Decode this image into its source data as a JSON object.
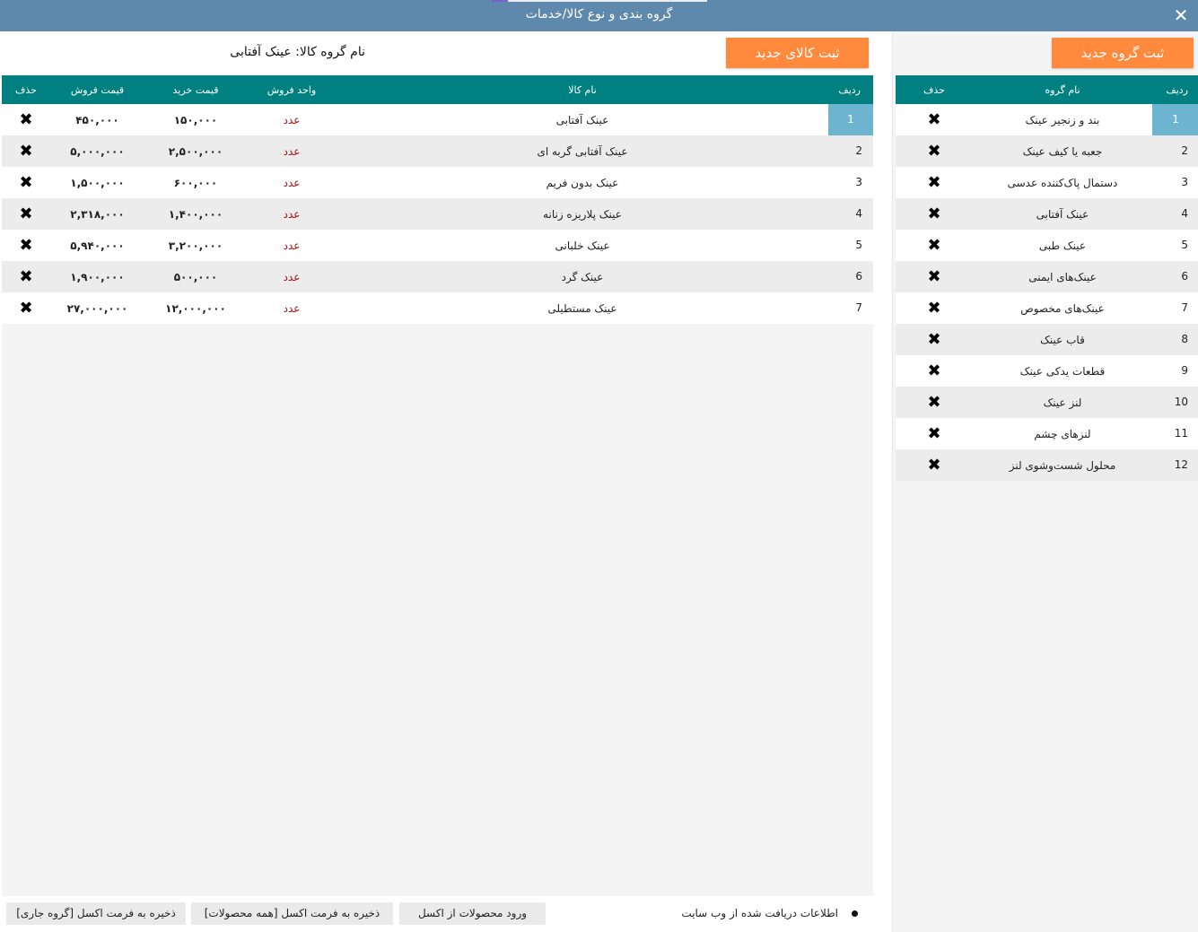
{
  "window": {
    "title": "گروه بندی و نوع کالا/خدمات",
    "close_glyph": "✕"
  },
  "groups": {
    "new_button": "ثبت گروه جدید",
    "headers": {
      "row": "ردیف",
      "name": "نام گروه",
      "delete": "حذف"
    },
    "rows": [
      {
        "num": "1",
        "name": "بند و زنجیر عینک"
      },
      {
        "num": "2",
        "name": "جعبه یا کیف عینک"
      },
      {
        "num": "3",
        "name": "دستمال پاک‌کننده عدسی"
      },
      {
        "num": "4",
        "name": "عینک آفتابی"
      },
      {
        "num": "5",
        "name": "عینک طبی"
      },
      {
        "num": "6",
        "name": "عینک‌های ایمنی"
      },
      {
        "num": "7",
        "name": "عینک‌های مخصوص"
      },
      {
        "num": "8",
        "name": "قاب عینک"
      },
      {
        "num": "9",
        "name": "قطعات یدکی عینک"
      },
      {
        "num": "10",
        "name": "لنز عینک"
      },
      {
        "num": "11",
        "name": "لنزهای چشم"
      },
      {
        "num": "12",
        "name": "محلول شست‌وشوی لنز"
      }
    ],
    "selected_index": 0
  },
  "products": {
    "new_button": "ثبت کالای جدید",
    "group_label": "نام گروه کالا: عینک آفتابی",
    "headers": {
      "row": "ردیف",
      "name": "نام کالا",
      "unit": "واحد فروش",
      "buy": "قیمت خرید",
      "sell": "قیمت فروش",
      "delete": "حذف"
    },
    "rows": [
      {
        "num": "1",
        "name": "عینک آفتابی",
        "unit": "عدد",
        "buy": "۱۵۰,۰۰۰",
        "sell": "۴۵۰,۰۰۰"
      },
      {
        "num": "2",
        "name": "عینک آفتابی گربه ای",
        "unit": "عدد",
        "buy": "۲,۵۰۰,۰۰۰",
        "sell": "۵,۰۰۰,۰۰۰"
      },
      {
        "num": "3",
        "name": "عینک بدون فریم",
        "unit": "عدد",
        "buy": "۶۰۰,۰۰۰",
        "sell": "۱,۵۰۰,۰۰۰"
      },
      {
        "num": "4",
        "name": "عینک پلاریزه زنانه",
        "unit": "عدد",
        "buy": "۱,۴۰۰,۰۰۰",
        "sell": "۲,۳۱۸,۰۰۰"
      },
      {
        "num": "5",
        "name": "عینک خلبانی",
        "unit": "عدد",
        "buy": "۳,۲۰۰,۰۰۰",
        "sell": "۵,۹۴۰,۰۰۰"
      },
      {
        "num": "6",
        "name": "عینک گرد",
        "unit": "عدد",
        "buy": "۵۰۰,۰۰۰",
        "sell": "۱,۹۰۰,۰۰۰"
      },
      {
        "num": "7",
        "name": "عینک مستطیلی",
        "unit": "عدد",
        "buy": "۱۲,۰۰۰,۰۰۰",
        "sell": "۲۷,۰۰۰,۰۰۰"
      }
    ],
    "selected_index": 0
  },
  "footer": {
    "info_text": "اطلاعات دریافت شده از وب سایت",
    "import_button": "ورود محصولات از اکسل",
    "export_all_button": "ذخیره به فرمت اکسل [همه محصولات]",
    "export_current_button": "ذخیره به فرمت اکسل [گروه جاری]"
  },
  "delete_glyph": "✖",
  "colors": {
    "titlebar": "#5f88ad",
    "header": "#008080",
    "orange": "#ff8a3d",
    "selected": "#6cb4d0",
    "unit": "#a01010"
  }
}
